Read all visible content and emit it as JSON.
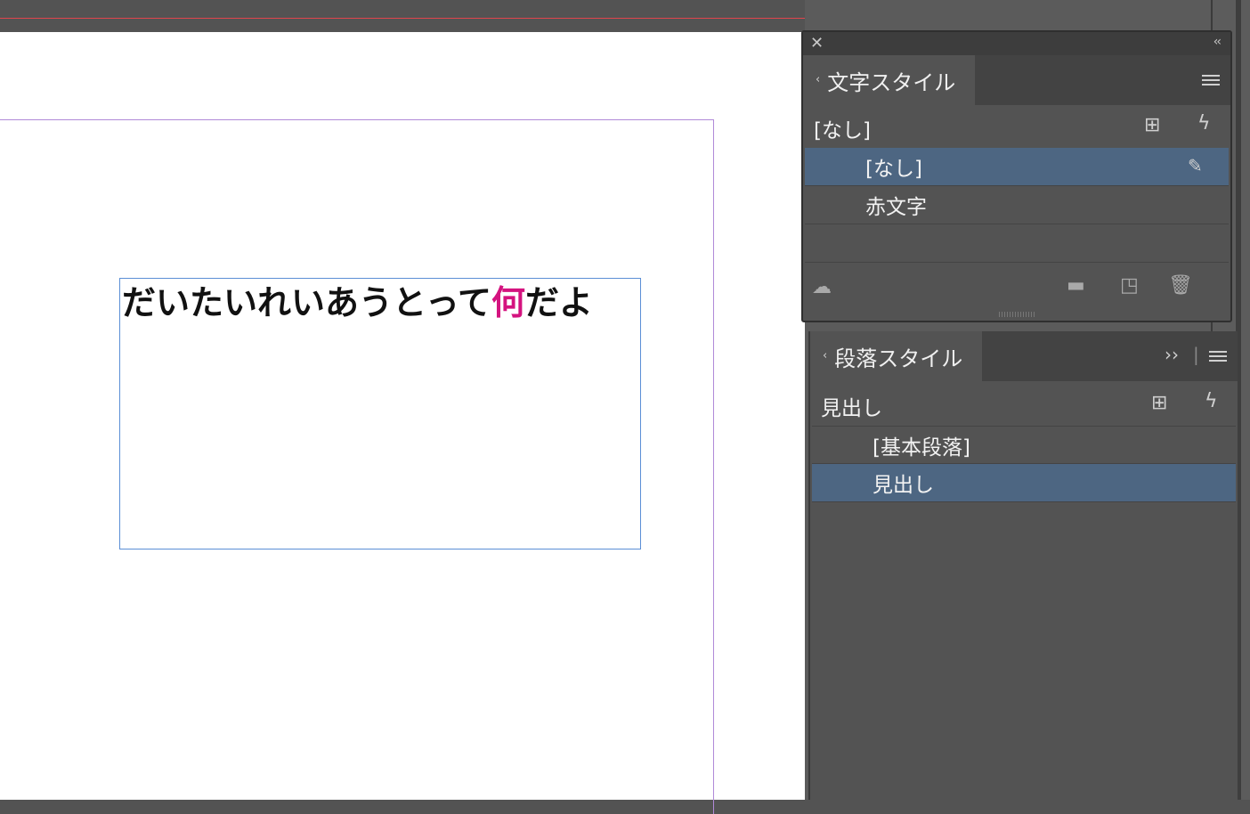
{
  "document": {
    "text_before": "だいたいれいあうとって",
    "text_red": "何",
    "text_after": "だよ",
    "red_color": "#d4137f"
  },
  "char_styles_panel": {
    "close_icon": "close-icon",
    "collapse_icon": "double-chevron-left-icon",
    "tab_label": "文字スタイル",
    "current_style": "[なし]",
    "items": [
      {
        "label": "[なし]",
        "selected": true,
        "icon": "pencil-crossed-icon"
      },
      {
        "label": "赤文字",
        "selected": false
      }
    ],
    "footer_icons": [
      "cloud-library-icon",
      "folder-icon",
      "new-style-icon",
      "trash-icon"
    ]
  },
  "para_styles_panel": {
    "tab_label": "段落スタイル",
    "current_style": "見出し",
    "items": [
      {
        "label": "[基本段落]",
        "selected": false
      },
      {
        "label": "見出し",
        "selected": true
      }
    ]
  },
  "colors": {
    "selection": "#4d6682",
    "panel_bg": "#535353",
    "frame_border": "#5b8fd6",
    "margin_guide": "#b18ad8"
  }
}
